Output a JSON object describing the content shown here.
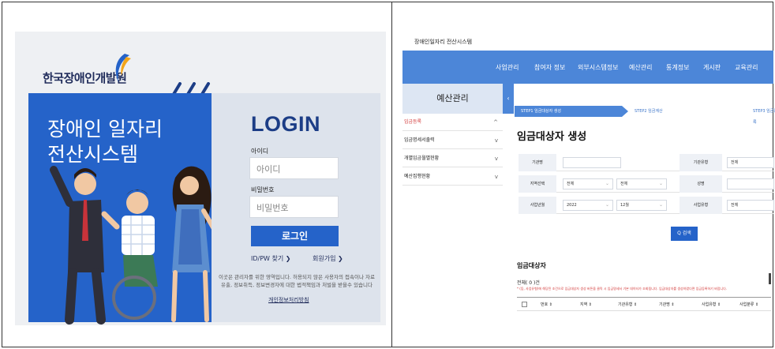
{
  "login": {
    "org_name": "한국장애인개발원",
    "headline_1": "장애인 일자리",
    "headline_2": "전산시스템",
    "title": "LOGIN",
    "id_label": "아이디",
    "id_placeholder": "아이디",
    "pw_label": "비밀번호",
    "pw_placeholder": "비밀번호",
    "login_button": "로그인",
    "find_link": "ID/PW 찾기 ❯",
    "signup_link": "회원가입 ❯",
    "notice": "이곳은 관리자를 위한 영역입니다. 허용되지 않은 사용자의 접속이나 자료 유출, 정보취득, 정보변경자에 대한 법적책임과 처벌을 받을수 있습니다",
    "privacy_link": "개인정보처리방침"
  },
  "app": {
    "title": "장애인일자리 전산시스템",
    "nav": [
      "사업관리",
      "참여자 정보",
      "외부시스템정보",
      "예산관리",
      "통계정보",
      "게시판",
      "교육관리"
    ],
    "sidebar": {
      "header": "예산관리",
      "toggle": "‹",
      "items": [
        {
          "label": "임금등록",
          "chev": "^"
        },
        {
          "label": "임금명세서출력",
          "chev": "v"
        },
        {
          "label": "개별임금월별현황",
          "chev": "v"
        },
        {
          "label": "예산집행현황",
          "chev": "v"
        }
      ]
    },
    "steps": [
      "STEP1 임금대상자 생성",
      "STEP2 임금계산",
      "STEP3 임금등록"
    ],
    "page_title": "임금대상자 생성",
    "search": {
      "org_label": "기관명",
      "org_type_label": "기관유형",
      "org_type_value": "전체",
      "region_label": "지역선택",
      "region_value1": "전체",
      "region_value2": "전체",
      "name_label": "성명",
      "date_label": "사업년월",
      "year_value": "2022",
      "month_value": "12월",
      "biz_type_label": "사업유형",
      "biz_type_value": "전체",
      "search_button": "Q 검색"
    },
    "list": {
      "title": "임금대상자",
      "count": "전체( 0 )건",
      "warning": "* (등, 사업유형)에 해당된 조건으로 임금대상자 생성 버튼을 클릭 시 임금명세서 기본 데이터가 조회됩니다. 임금대상자를 생성하였다면 임금등록하기 바랍니다.",
      "columns": [
        "번호 ⇕",
        "지역 ⇕",
        "기관유형 ⇕",
        "기관명 ⇕",
        "사업유형 ⇕",
        "사업분류 ⇕"
      ]
    }
  },
  "colors": {
    "primary_blue": "#2563c9",
    "nav_blue": "#4c86d8",
    "navy": "#1f2b5a",
    "alert_red": "#d23838"
  }
}
